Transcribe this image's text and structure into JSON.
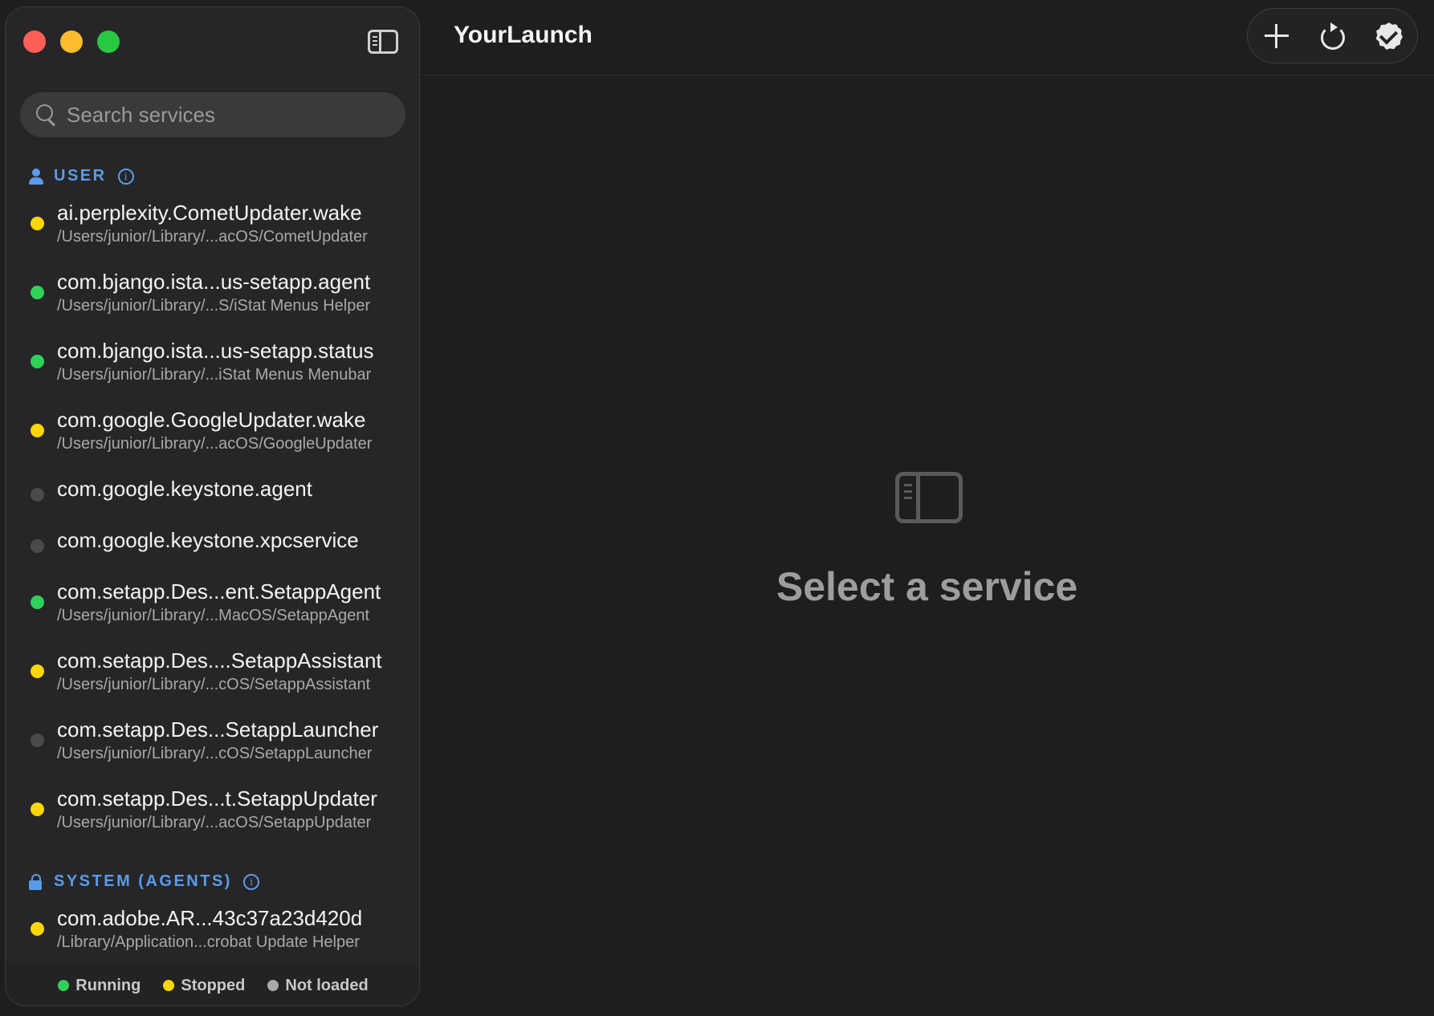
{
  "app": {
    "title": "YourLaunch"
  },
  "search": {
    "placeholder": "Search services",
    "value": ""
  },
  "sections": {
    "user": {
      "label": "USER"
    },
    "system_agents": {
      "label": "SYSTEM (AGENTS)"
    }
  },
  "status_colors": {
    "running": "#30d158",
    "stopped": "#ffd60a",
    "not_loaded": "#4a4a4c"
  },
  "services": [
    {
      "name": "ai.perplexity.CometUpdater.wake",
      "path": "/Users/junior/Library/...acOS/CometUpdater",
      "status": "stopped"
    },
    {
      "name": "com.bjango.ista...us-setapp.agent",
      "path": "/Users/junior/Library/...S/iStat Menus Helper",
      "status": "running"
    },
    {
      "name": "com.bjango.ista...us-setapp.status",
      "path": "/Users/junior/Library/...iStat Menus Menubar",
      "status": "running"
    },
    {
      "name": "com.google.GoogleUpdater.wake",
      "path": "/Users/junior/Library/...acOS/GoogleUpdater",
      "status": "stopped"
    },
    {
      "name": "com.google.keystone.agent",
      "path": "",
      "status": "not_loaded"
    },
    {
      "name": "com.google.keystone.xpcservice",
      "path": "",
      "status": "not_loaded"
    },
    {
      "name": "com.setapp.Des...ent.SetappAgent",
      "path": "/Users/junior/Library/...MacOS/SetappAgent",
      "status": "running"
    },
    {
      "name": "com.setapp.Des....SetappAssistant",
      "path": "/Users/junior/Library/...cOS/SetappAssistant",
      "status": "stopped"
    },
    {
      "name": "com.setapp.Des...SetappLauncher",
      "path": "/Users/junior/Library/...cOS/SetappLauncher",
      "status": "not_loaded"
    },
    {
      "name": "com.setapp.Des...t.SetappUpdater",
      "path": "/Users/junior/Library/...acOS/SetappUpdater",
      "status": "stopped"
    }
  ],
  "system_services": [
    {
      "name": "com.adobe.AR...43c37a23d420d",
      "path": "/Library/Application...crobat Update Helper",
      "status": "stopped"
    }
  ],
  "legend": {
    "running": "Running",
    "stopped": "Stopped",
    "not_loaded": "Not loaded"
  },
  "empty_state": {
    "text": "Select a service",
    "icon": "sidebar-icon"
  },
  "toolbar": {
    "icons": [
      "plus-icon",
      "refresh-icon",
      "verified-icon"
    ]
  }
}
